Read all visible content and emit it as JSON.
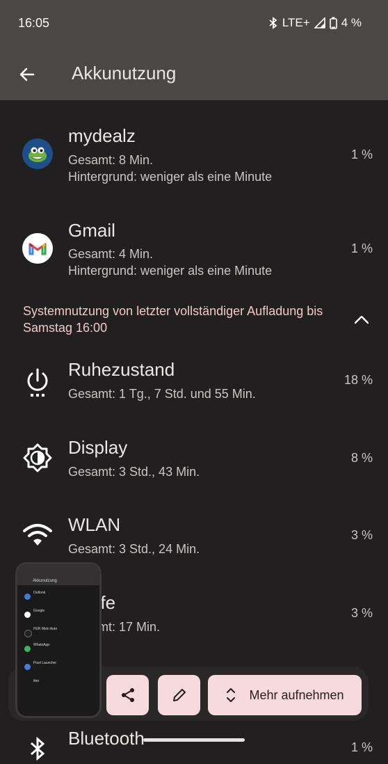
{
  "status": {
    "time": "16:05",
    "network": "LTE+",
    "battery": "4 %"
  },
  "header": {
    "title": "Akkunutzung"
  },
  "apps": [
    {
      "name": "mydealz",
      "line1": "Gesamt: 8 Min.",
      "line2": "Hintergrund: weniger als eine Minute",
      "percent": "1 %"
    },
    {
      "name": "Gmail",
      "line1": "Gesamt: 4 Min.",
      "line2": "Hintergrund: weniger als eine Minute",
      "percent": "1 %"
    }
  ],
  "system_section": {
    "header": "Systemnutzung von letzter vollständiger Aufladung bis Samstag 16:00"
  },
  "system": [
    {
      "name": "Ruhezustand",
      "line1": "Gesamt: 1 Tg., 7 Std. und 55 Min.",
      "percent": "18 %"
    },
    {
      "name": "Display",
      "line1": "Gesamt: 3 Std., 43 Min.",
      "percent": "8 %"
    },
    {
      "name": "WLAN",
      "line1": "Gesamt: 3 Std., 24 Min.",
      "percent": "3 %"
    },
    {
      "name": "ufe",
      "line1": "mt: 17 Min.",
      "percent": "3 %"
    },
    {
      "name": "Bluetooth",
      "percent": "1 %"
    }
  ],
  "toolbar": {
    "capture_more_label": "Mehr aufnehmen"
  },
  "thumbnail": {
    "title": "Akkunutzung",
    "items": [
      "Outlook",
      "Google",
      "HUK Mein Auto",
      "WhatsApp",
      "Pixel Launcher",
      "itter"
    ]
  },
  "colors": {
    "accent_pink": "#f6dadd",
    "section_header": "#f0c9cb",
    "background": "#211f1f",
    "app_bar": "#4a4745"
  }
}
